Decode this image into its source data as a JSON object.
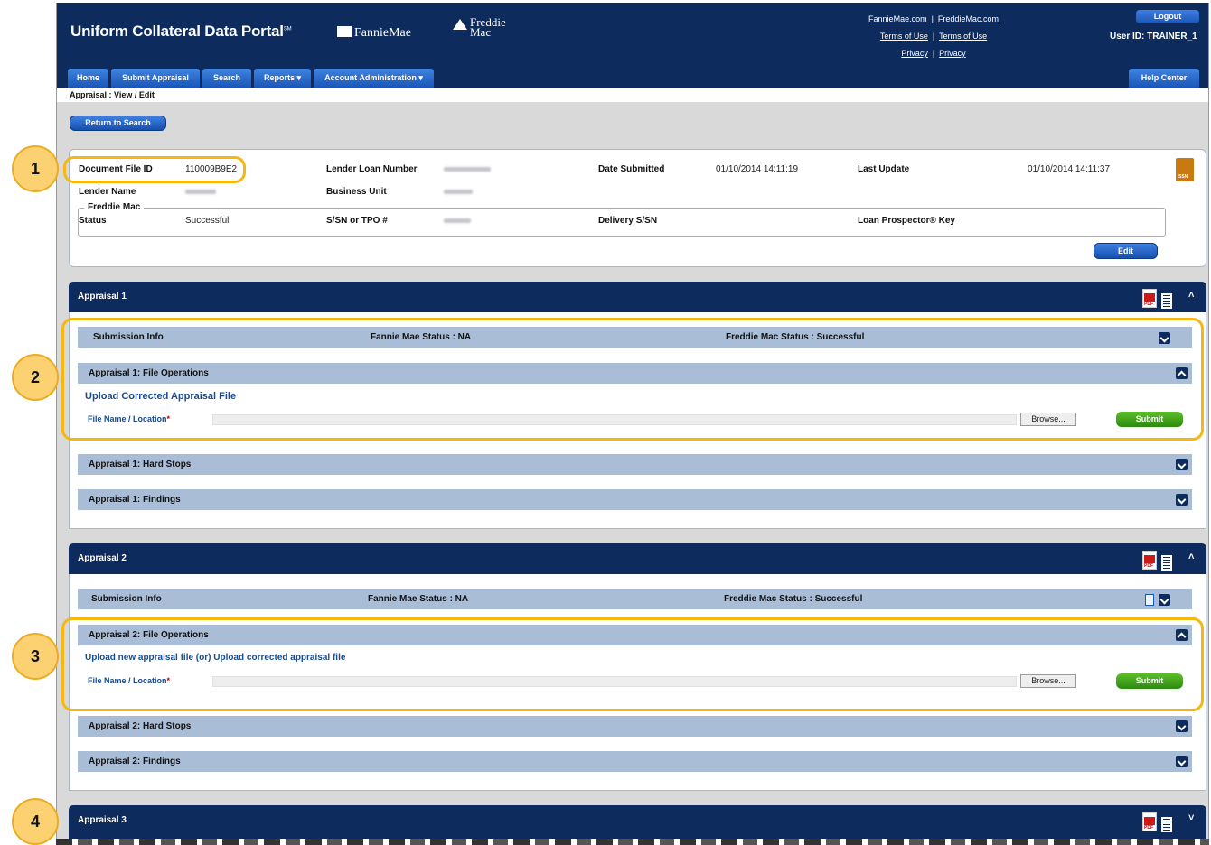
{
  "header": {
    "brand": "Uniform Collateral Data Portal",
    "brand_sm": "SM",
    "fanniemae": "FannieMae",
    "freddie1": "Freddie",
    "freddie2": "Mac",
    "links_row1": [
      "FannieMae.com",
      "FreddieMac.com"
    ],
    "links_row2": [
      "Terms of Use",
      "Terms of Use"
    ],
    "links_row3": [
      "Privacy",
      "Privacy"
    ],
    "logout": "Logout",
    "user_id": "User ID: TRAINER_1"
  },
  "nav": {
    "tabs": [
      "Home",
      "Submit Appraisal",
      "Search",
      "Reports ▾",
      "Account Administration ▾"
    ],
    "help": "Help Center"
  },
  "breadcrumb": "Appraisal : View / Edit",
  "return_button": "Return to Search",
  "doc": {
    "file_id_label": "Document File ID",
    "file_id": "110009B9E2",
    "loan_label": "Lender Loan Number",
    "date_label": "Date Submitted",
    "date": "01/10/2014 14:11:19",
    "update_label": "Last Update",
    "update": "01/10/2014 14:11:37",
    "lender_label": "Lender Name",
    "unit_label": "Business Unit",
    "freddie_legend": "Freddie Mac",
    "status_label": "Status",
    "status": "Successful",
    "ssn_label": "S/SN or TPO #",
    "delivery_label": "Delivery S/SN",
    "lp_label": "Loan Prospector® Key",
    "edit": "Edit",
    "ssn_icon": "SSN"
  },
  "appraisals": [
    {
      "title": "Appraisal 1",
      "submission": "Submission Info",
      "fm_status": "Fannie Mae Status : NA",
      "fdm_status": "Freddie Mac Status : Successful",
      "file_ops": "Appraisal 1: File Operations",
      "upload_title": "Upload Corrected Appraisal File",
      "file_label": "File Name / Location",
      "browse": "Browse...",
      "submit": "Submit",
      "hard_stops": "Appraisal 1: Hard Stops",
      "findings": "Appraisal 1: Findings"
    },
    {
      "title": "Appraisal 2",
      "submission": "Submission Info",
      "fm_status": "Fannie Mae Status : NA",
      "fdm_status": "Freddie Mac Status : Successful",
      "file_ops": "Appraisal 2: File Operations",
      "upload_title": "Upload new appraisal file (or) Upload corrected appraisal file",
      "file_label": "File Name / Location",
      "browse": "Browse...",
      "submit": "Submit",
      "hard_stops": "Appraisal 2: Hard Stops",
      "findings": "Appraisal 2: Findings"
    },
    {
      "title": "Appraisal 3"
    }
  ],
  "callouts": [
    "1",
    "2",
    "3",
    "4"
  ],
  "icons": {
    "pdf": "pdf-icon",
    "pdf_text": "PDF",
    "doc": "document-icon"
  },
  "colors": {
    "navy": "#0d2b5c",
    "highlight": "#f5b80e",
    "section": "#a9bdd6"
  }
}
